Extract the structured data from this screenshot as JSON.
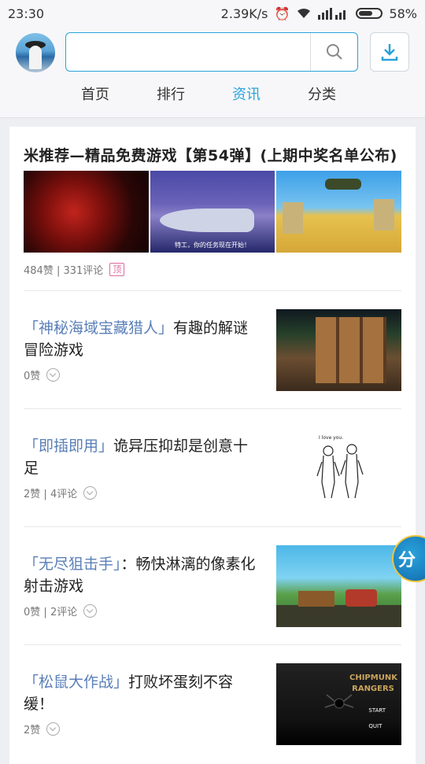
{
  "status_bar": {
    "time": "23:30",
    "network_speed": "2.39K/s",
    "battery": "58%",
    "icons": [
      "alarm-icon",
      "wifi-icon",
      "signal-icon",
      "battery-icon"
    ]
  },
  "header": {
    "search_placeholder": "",
    "tabs": [
      {
        "label": "首页",
        "active": false
      },
      {
        "label": "排行",
        "active": false
      },
      {
        "label": "资讯",
        "active": true
      },
      {
        "label": "分类",
        "active": false
      }
    ]
  },
  "featured": {
    "title": "米推荐—精品免费游戏【第54弹】(上期中奖名单公布)",
    "image_captions": [
      "",
      "特工，你的任务现在开始！",
      ""
    ],
    "likes": "484赞",
    "comments": "331评论",
    "tag": "顶"
  },
  "articles": [
    {
      "bracket": "「神秘海域宝藏猎人」",
      "title": "有趣的解谜冒险游戏",
      "likes": "0赞",
      "comments": ""
    },
    {
      "bracket": "「即插即用」",
      "title": "诡异压抑却是创意十足",
      "likes": "2赞",
      "comments": "4评论",
      "thumb_text": "I love you."
    },
    {
      "bracket": "「无尽狙击手」",
      "title": "：畅快淋漓的像素化射击游戏",
      "likes": "0赞",
      "comments": "2评论"
    },
    {
      "bracket": "「松鼠大作战」",
      "title": "打败坏蛋刻不容缓！",
      "likes": "2赞",
      "comments": "",
      "thumb_logo": "CHIPMUNK RANGERS",
      "thumb_menu": [
        "START",
        "QUIT"
      ]
    }
  ],
  "float_button": {
    "label": "分"
  },
  "colors": {
    "accent": "#2aa3da",
    "bracket": "#5a7fb8",
    "tag": "#e06aa0"
  }
}
